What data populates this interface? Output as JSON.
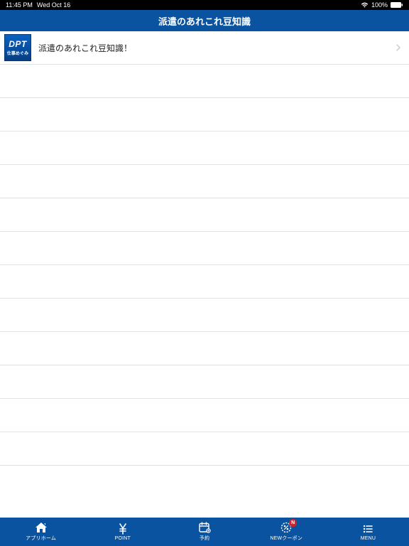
{
  "status": {
    "time": "11:45 PM",
    "date": "Wed Oct 16",
    "battery": "100%"
  },
  "header": {
    "title": "派遣のあれこれ豆知識"
  },
  "list": {
    "items": [
      {
        "icon_big": "DPT",
        "icon_small": "仕事めぐみ",
        "label": "派遣のあれこれ豆知識！"
      }
    ]
  },
  "tabs": {
    "home": "アプリホーム",
    "point": "POINT",
    "reserve": "予約",
    "coupon": "NEWクーポン",
    "coupon_badge": "N",
    "menu": "MENU"
  }
}
